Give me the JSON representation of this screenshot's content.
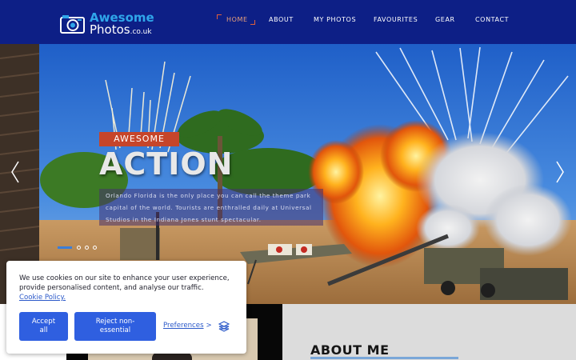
{
  "header": {
    "logo": {
      "line1": "Awesome",
      "line2": "Photos",
      "domain": ".co.uk",
      "icon": "camera-icon"
    },
    "nav": [
      {
        "label": "HOME",
        "active": true
      },
      {
        "label": "ABOUT",
        "active": false
      },
      {
        "label": "MY PHOTOS",
        "active": false
      },
      {
        "label": "FAVOURITES",
        "active": false
      },
      {
        "label": "GEAR",
        "active": false
      },
      {
        "label": "CONTACT",
        "active": false
      }
    ],
    "colors": {
      "background": "#0d1f86",
      "accent": "#2fa6ea",
      "active": "#e9a07b"
    }
  },
  "hero": {
    "tag": "AWESOME",
    "title": "ACTION",
    "description": "Orlando Florida is the only place you can call the theme park capital of the world. Tourists are enthralled daily at Universal Studios in the Indiana Jones stunt spectacular.",
    "prev_icon": "chevron-left-icon",
    "next_icon": "chevron-right-icon",
    "slides": 4,
    "active_slide": 1,
    "colors": {
      "tag": "#c6452a",
      "indicator": "#3c7ed8"
    }
  },
  "about": {
    "title": "ABOUT ME"
  },
  "cookie": {
    "text": "We use cookies on our site to enhance your user experience, provide personalised content, and analyse our traffic.",
    "policy_link": "Cookie Policy.",
    "accept_label": "Accept all",
    "reject_label": "Reject non-essential",
    "preferences_label": "Preferences",
    "preferences_arrow": ">",
    "logo_icon": "cookie-consent-logo-icon",
    "colors": {
      "button": "#2f5fe0",
      "link": "#2b59c9"
    }
  }
}
